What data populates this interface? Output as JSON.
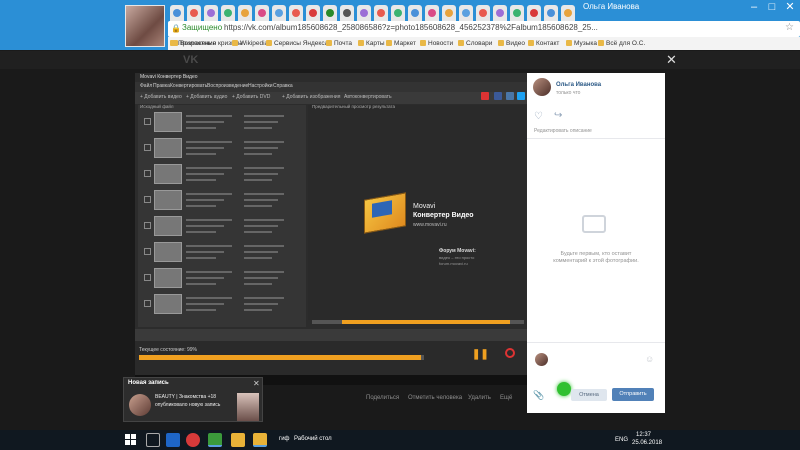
{
  "browser": {
    "profile_name": "Ольга Иванова",
    "window_controls": [
      "–",
      "□",
      "✕"
    ],
    "address": {
      "secure_label": "Защищено",
      "url": "https://vk.com/album185608628_258086586?z=photo185608628_456252378%2Falbum185608628_25..."
    },
    "bookmarks": [
      "Приложения",
      "Возрастные кризисы",
      "Wikipedia",
      "Сервисы Яндекса",
      "Почта",
      "Карты",
      "Маркет",
      "Новости",
      "Словари",
      "Видео",
      "Контакт",
      "Музыка",
      "Всё для О.С."
    ],
    "tab_colors": [
      "#4a90d9",
      "#e85a4f",
      "#9c6fd6",
      "#3cb371",
      "#e8a33d",
      "#d94a86",
      "#5aa0e0",
      "#e85a4f",
      "#d93a3a",
      "#2a8a2a",
      "#555555",
      "#9c6fd6",
      "#e85a4f",
      "#3cb371",
      "#4a90d9",
      "#d94a86",
      "#e8a33d",
      "#5aa0e0",
      "#e85a4f",
      "#9c6fd6",
      "#3cb371",
      "#d93a3a",
      "#4a90d9",
      "#e8a33d"
    ]
  },
  "vk": {
    "logo": "VK",
    "photo_actions": {
      "share": "Поделиться",
      "tag_person": "Отметить человека",
      "delete": "Удалить",
      "more": "Ещё"
    }
  },
  "movavi": {
    "window_title": "Movavi Конвертер Видео",
    "menu": [
      "Файл",
      "Правка",
      "Конвертировать",
      "Воспроизведение",
      "Настройки",
      "Справка"
    ],
    "toolbar": [
      "+ Добавить видео",
      "+ Добавить аудио",
      "+ Добавить DVD",
      "+ Добавить изображения",
      "Автоконвертировать"
    ],
    "left_header": "Исходный файл",
    "preview_header": "Предварительный просмотр результата",
    "logo_brand": "Movavi",
    "logo_product": "Конвертер Видео",
    "logo_url": "www.movavi.ru",
    "forum_title": "Форум Movavi:",
    "forum_line1": "видео – это просто",
    "forum_line2": "forum.movavi.ru",
    "status_label": "Текущее состояние: 99%",
    "progress_percent": 99,
    "pause_label": "Пауза",
    "stop_label": "Прервать"
  },
  "notification": {
    "title": "Новая запись",
    "line1": "BEAUTY | Знакомства +18",
    "line2": "опубликовало новую запись"
  },
  "comments": {
    "author_name": "Ольга Иванова",
    "time": "только что",
    "edit_description": "Редактировать описание",
    "empty_line1": "Будьте первым, кто оставит",
    "empty_line2": "комментарий к этой фотографии.",
    "cancel_label": "Отмена",
    "send_label": "Отправить"
  },
  "taskbar": {
    "desktop_label": "Рабочий стол",
    "gif_label": "гиф",
    "language": "ENG",
    "time": "12:37",
    "date": "25.06.2018"
  }
}
